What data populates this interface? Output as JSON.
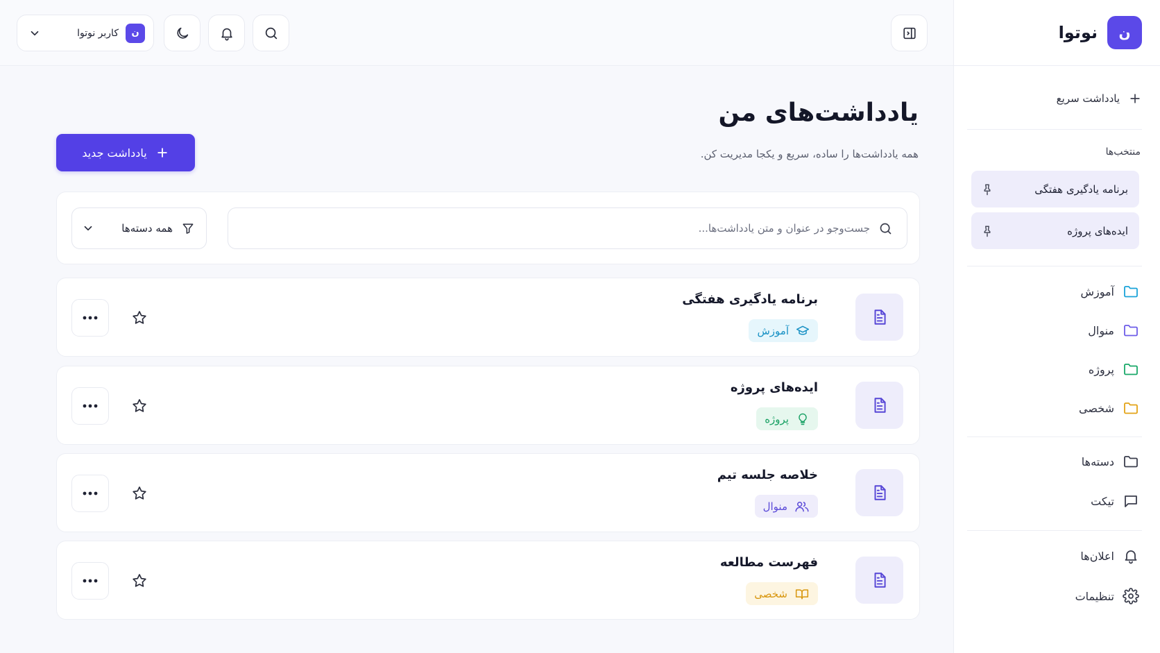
{
  "app": {
    "brand_name": "نوتوا",
    "logo_letter": "ن"
  },
  "sidebar": {
    "quick_note": "یادداشت سریع",
    "favorites_label": "منتخب‌ها",
    "pinned": [
      {
        "label": "برنامه یادگیری هفتگی",
        "icon": "pin-icon"
      },
      {
        "label": "ایده‌های پروژه",
        "icon": "pin-icon"
      }
    ],
    "folders": [
      {
        "label": "آموزش",
        "icon": "folder-icon",
        "color": "#1aa3d9"
      },
      {
        "label": "منوال",
        "icon": "folder-icon",
        "color": "#6d5ce8"
      },
      {
        "label": "پروژه",
        "icon": "folder-icon",
        "color": "#18a868"
      },
      {
        "label": "شخصی",
        "icon": "folder-icon",
        "color": "#e3a316"
      }
    ],
    "links": [
      {
        "label": "دسته‌ها",
        "icon": "folder-icon"
      },
      {
        "label": "تیکت",
        "icon": "chat-icon"
      }
    ],
    "bottom": [
      {
        "label": "اعلان‌ها",
        "icon": "bell-icon"
      },
      {
        "label": "تنظیمات",
        "icon": "gear-icon"
      }
    ]
  },
  "topbar": {
    "user_name": "کاربر نوتوا",
    "user_avatar_letter": "ن"
  },
  "main": {
    "title": "یادداشت‌های من",
    "subtitle": "همه یادداشت‌ها را ساده، سریع و یکجا مدیریت کن.",
    "new_note_label": "یادداشت جدید",
    "search_placeholder": "جست‌وجو در عنوان و متن یادداشت‌ها...",
    "category_filter": "همه دسته‌ها",
    "notes": [
      {
        "title": "برنامه یادگیری هفتگی",
        "tag": "آموزش",
        "tag_icon": "graduation-cap-icon",
        "tag_color": "#1690c4",
        "tag_bg": "#e6f6fc"
      },
      {
        "title": "ایده‌های پروژه",
        "tag": "پروژه",
        "tag_icon": "lightbulb-icon",
        "tag_color": "#17a063",
        "tag_bg": "#e6f7ee"
      },
      {
        "title": "خلاصه جلسه تیم",
        "tag": "منوال",
        "tag_icon": "users-icon",
        "tag_color": "#5b4ad8",
        "tag_bg": "#efedfb"
      },
      {
        "title": "فهرست مطالعه",
        "tag": "شخصی",
        "tag_icon": "book-icon",
        "tag_color": "#d8960e",
        "tag_bg": "#fdf5e1"
      }
    ]
  },
  "colors": {
    "accent": "#5340e6",
    "accent_soft": "#eeedfb"
  }
}
